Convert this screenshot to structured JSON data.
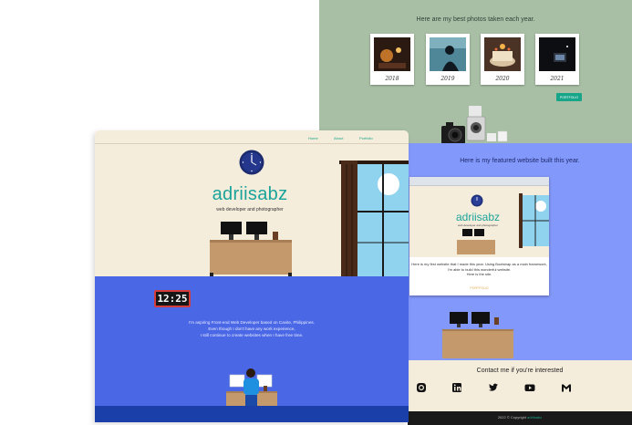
{
  "photos_section": {
    "title": "Here are my best photos taken each year.",
    "items": [
      {
        "year": "2018",
        "tone": "#3a2418"
      },
      {
        "year": "2019",
        "tone": "#3f6d7c"
      },
      {
        "year": "2020",
        "tone": "#6a4a33"
      },
      {
        "year": "2021",
        "tone": "#101216"
      }
    ],
    "button_label": "PORTFOLIO",
    "accent": "#17a589"
  },
  "featured_section": {
    "title": "Here is my featured website built this year.",
    "preview": {
      "brand": "adriisabz",
      "subtitle": "web developer and photographer",
      "description_lines": [
        "Here is my first website that I made this year. Using Bootstrap as a main framework,",
        "I'm able to build this wonderful website.",
        "Here is the site."
      ],
      "link_label": "PORTFOLIO"
    }
  },
  "contact_section": {
    "title": "Contact me if you're interested",
    "icons": [
      "instagram-icon",
      "linkedin-icon",
      "twitter-icon",
      "youtube-icon",
      "gmail-icon"
    ]
  },
  "footer": {
    "text_prefix": "2022 © Copyright",
    "text_accent": "adriisabz"
  },
  "hero": {
    "nav": [
      "Home",
      "About",
      "Portfolio"
    ],
    "brand": "adriisabz",
    "tagline": "web developer and photographer",
    "clock_time": "12:25",
    "about_lines": [
      "I'm aspiring Front-end Web Developer based on Cavite, Philippines.",
      "Even though I don't have any work experience,",
      "I still continue to create websites when I have free time."
    ],
    "colors": {
      "cream": "#f5eddc",
      "blue": "#4a67e6",
      "teal": "#1aa39a"
    }
  }
}
